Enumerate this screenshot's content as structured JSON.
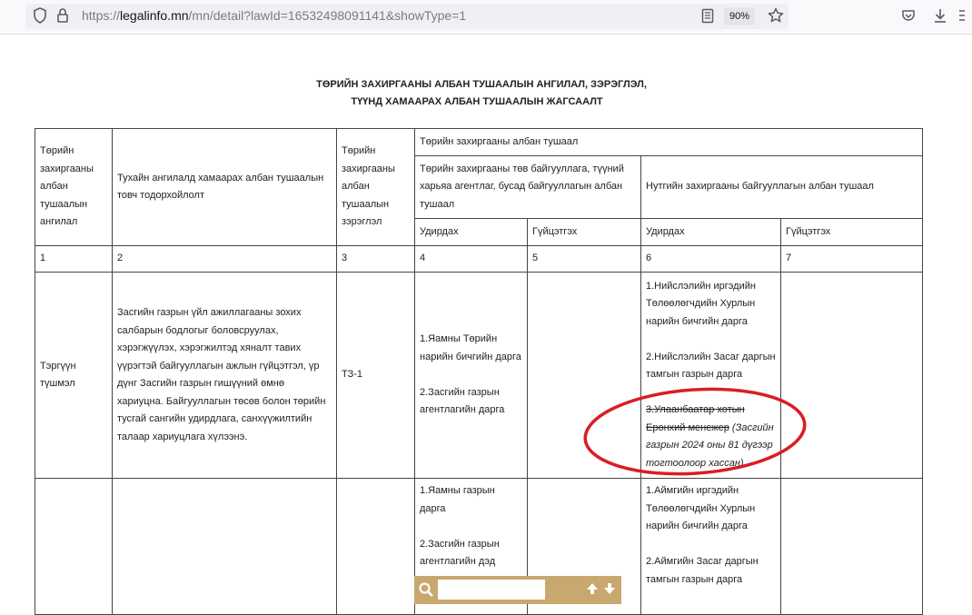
{
  "browser": {
    "url_prefix": "https://",
    "url_host": "legalinfo.mn",
    "url_path": "/mn/detail?lawId=16532498091141&showType=1",
    "zoom": "90%"
  },
  "document": {
    "title_line1": "ТӨРИЙН ЗАХИРГААНЫ АЛБАН ТУШААЛЫН АНГИЛАЛ, ЗЭРЭГЛЭЛ,",
    "title_line2": "ТҮҮНД ХАМААРАХ АЛБАН ТУШААЛЫН ЖАГСААЛТ",
    "headers": {
      "col1": "Төрийн захиргааны албан тушаалын ангилал",
      "col2": "Тухайн ангилалд хамаарах албан тушаалын товч тодорхойлолт",
      "col3": "Төрийн захиргааны албан тушаалын зэрэглэл",
      "group": "Төрийн захиргааны албан тушаал",
      "central": "Төрийн захиргааны төв байгууллага, түүний харьяа агентлаг, бусад байгууллагын албан тушаал",
      "local": "Нутгийн захиргааны байгууллагын албан тушаал",
      "lead": "Удирдах",
      "exec": "Гүйцэтгэх"
    },
    "numbers": [
      "1",
      "2",
      "3",
      "4",
      "5",
      "6",
      "7"
    ],
    "row1": {
      "category": "Тэргүүн түшмэл",
      "description": "Засгийн газрын үйл ажиллагааны зохих салбарын бодлогыг боловсруулах, хэрэгжүүлэх, хэрэгжилтэд хяналт тавих үүрэгтэй байгууллагын ажлын гүйцэтгэл, үр дүнг  Засгийн газрын гишүүний өмнө хариуцна. Байгууллагын төсөв болон төрийн тусгай сангийн удирдлага, санхүүжилтийн талаар хариуцлага хүлээнэ.",
      "rank": "ТЗ-1",
      "central_lead_1": "1.Яамны Төрийн нарийн бичгийн дарга",
      "central_lead_2": "2.Засгийн газрын агентлагийн дарга",
      "local_lead_1": "1.Нийслэлийн иргэдийн Төлөөлөгчдийн Хурлын нарийн бичгийн дарга",
      "local_lead_2": "2.Нийслэлийн Засаг даргын тамгын газрын дарга",
      "local_lead_3_struck": "3.Улаанбаатар хотын Ерөнхий менежер",
      "local_lead_3_note": "(Засгийн газрын 2024 оны 81 дүгээр тогтоолоор хассан)"
    },
    "row2": {
      "central_lead_1": "1.Яамны газрын дарга",
      "central_lead_2": "2.Засгийн газрын агентлагийн дэд",
      "local_lead_1": "1.Аймгийн иргэдийн Төлөөлөгчдийн Хурлын нарийн бичгийн дарга",
      "local_lead_2": "2.Аймгийн Засаг даргын тамгын газрын дарга"
    }
  },
  "findbar": {
    "value": ""
  },
  "icons": [
    "shield-icon",
    "lock-icon",
    "reader-view-icon",
    "star-icon",
    "pocket-icon",
    "download-icon",
    "search-icon",
    "arrow-up-icon",
    "arrow-down-icon"
  ],
  "colors": {
    "annotation": "#d81e25",
    "findbar": "#c8a86e"
  }
}
